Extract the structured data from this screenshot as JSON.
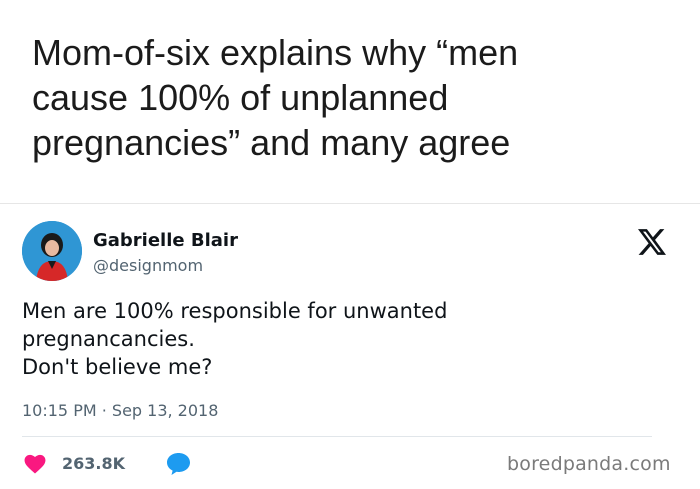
{
  "headline": {
    "lines": [
      "Mom-of-six explains why “men",
      "cause 100% of unplanned",
      "pregnancies” and many agree"
    ]
  },
  "tweet": {
    "author": {
      "display_name": "Gabrielle Blair",
      "handle": "@designmom",
      "avatar_icon": "profile-photo"
    },
    "platform_icon": "x-logo-icon",
    "text_lines": [
      "Men are 100% responsible for unwanted",
      "pregnancancies.",
      "Don't believe me?"
    ],
    "timestamp": "10:15 PM · Sep 13, 2018",
    "likes": "263.8K",
    "like_icon": "heart-icon",
    "reply_icon": "speech-bubble-icon"
  },
  "watermark": "boredpanda.com",
  "colors": {
    "heart": "#f91880",
    "reply": "#1d9bf0",
    "secondary_text": "#536471"
  }
}
